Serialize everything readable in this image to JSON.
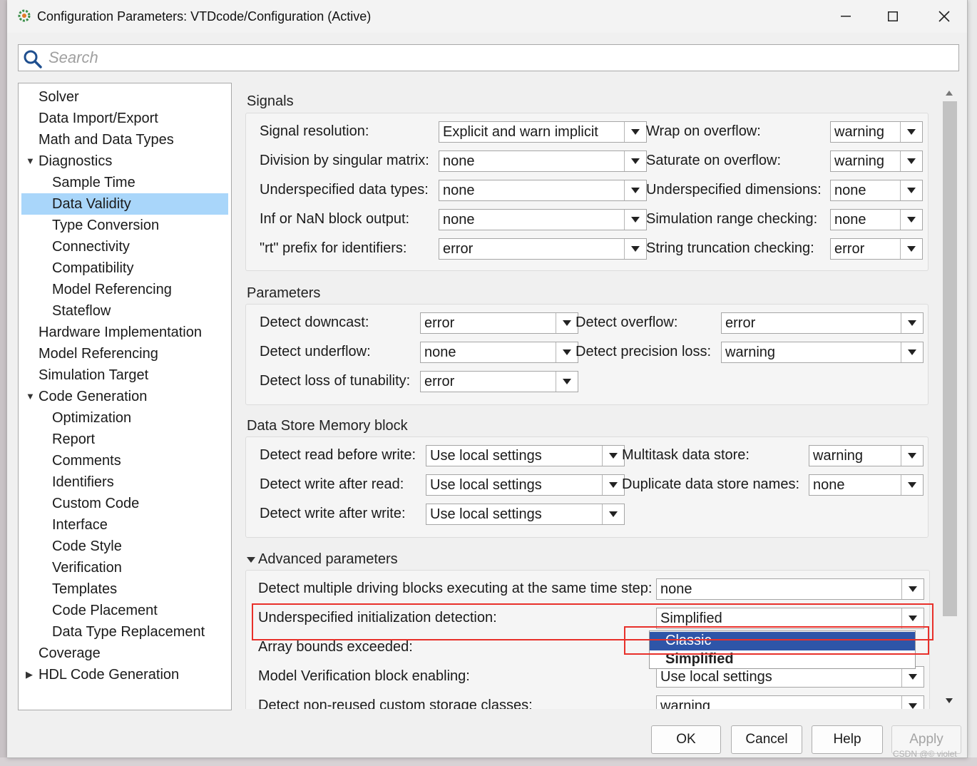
{
  "window": {
    "title": "Configuration Parameters: VTDcode/Configuration (Active)",
    "minimize": "—",
    "maximize": "☐",
    "close": "✕"
  },
  "search": {
    "placeholder": "Search"
  },
  "tree": [
    {
      "label": "Solver",
      "level": 0
    },
    {
      "label": "Data Import/Export",
      "level": 0
    },
    {
      "label": "Math and Data Types",
      "level": 0
    },
    {
      "label": "Diagnostics",
      "level": 0,
      "expanded": true
    },
    {
      "label": "Sample Time",
      "level": 1
    },
    {
      "label": "Data Validity",
      "level": 1,
      "selected": true
    },
    {
      "label": "Type Conversion",
      "level": 1
    },
    {
      "label": "Connectivity",
      "level": 1
    },
    {
      "label": "Compatibility",
      "level": 1
    },
    {
      "label": "Model Referencing",
      "level": 1
    },
    {
      "label": "Stateflow",
      "level": 1
    },
    {
      "label": "Hardware Implementation",
      "level": 0
    },
    {
      "label": "Model Referencing",
      "level": 0
    },
    {
      "label": "Simulation Target",
      "level": 0
    },
    {
      "label": "Code Generation",
      "level": 0,
      "expanded": true
    },
    {
      "label": "Optimization",
      "level": 1
    },
    {
      "label": "Report",
      "level": 1
    },
    {
      "label": "Comments",
      "level": 1
    },
    {
      "label": "Identifiers",
      "level": 1
    },
    {
      "label": "Custom Code",
      "level": 1
    },
    {
      "label": "Interface",
      "level": 1
    },
    {
      "label": "Code Style",
      "level": 1
    },
    {
      "label": "Verification",
      "level": 1
    },
    {
      "label": "Templates",
      "level": 1
    },
    {
      "label": "Code Placement",
      "level": 1
    },
    {
      "label": "Data Type Replacement",
      "level": 1
    },
    {
      "label": "Coverage",
      "level": 0
    },
    {
      "label": "HDL Code Generation",
      "level": 0,
      "expanded": false
    }
  ],
  "signals": {
    "title": "Signals",
    "left": [
      {
        "label": "Signal resolution:",
        "value": "Explicit and warn implicit"
      },
      {
        "label": "Division by singular matrix:",
        "value": "none"
      },
      {
        "label": "Underspecified data types:",
        "value": "none"
      },
      {
        "label": "Inf or NaN block output:",
        "value": "none"
      },
      {
        "label": "\"rt\" prefix for identifiers:",
        "value": "error"
      }
    ],
    "right": [
      {
        "label": "Wrap on overflow:",
        "value": "warning"
      },
      {
        "label": "Saturate on overflow:",
        "value": "warning"
      },
      {
        "label": "Underspecified dimensions:",
        "value": "none"
      },
      {
        "label": "Simulation range checking:",
        "value": "none"
      },
      {
        "label": "String truncation checking:",
        "value": "error"
      }
    ]
  },
  "parameters": {
    "title": "Parameters",
    "left": [
      {
        "label": "Detect downcast:",
        "value": "error"
      },
      {
        "label": "Detect underflow:",
        "value": "none"
      },
      {
        "label": "Detect loss of tunability:",
        "value": "error"
      }
    ],
    "right": [
      {
        "label": "Detect overflow:",
        "value": "error"
      },
      {
        "label": "Detect precision loss:",
        "value": "warning"
      }
    ]
  },
  "dsm": {
    "title": "Data Store Memory block",
    "left": [
      {
        "label": "Detect read before write:",
        "value": "Use local settings"
      },
      {
        "label": "Detect write after read:",
        "value": "Use local settings"
      },
      {
        "label": "Detect write after write:",
        "value": "Use local settings"
      }
    ],
    "right": [
      {
        "label": "Multitask data store:",
        "value": "warning"
      },
      {
        "label": "Duplicate data store names:",
        "value": "none"
      }
    ]
  },
  "advanced": {
    "title": "Advanced parameters",
    "rows": [
      {
        "label": "Detect multiple driving blocks executing at the same time step:",
        "value": "none"
      },
      {
        "label": "Underspecified initialization detection:",
        "value": "Simplified"
      },
      {
        "label": "Array bounds exceeded:",
        "value": ""
      },
      {
        "label": "Model Verification block enabling:",
        "value": "Use local settings"
      },
      {
        "label": "Detect non-reused custom storage classes:",
        "value": "warning"
      }
    ],
    "popup_options": [
      "Classic",
      "Simplified"
    ]
  },
  "buttons": {
    "ok": "OK",
    "cancel": "Cancel",
    "help": "Help",
    "apply": "Apply"
  },
  "watermark": "CSDN @© violet",
  "colors": {
    "selection": "#a9d6fa",
    "popup_highlight": "#2e55a8",
    "annotation_red": "#e8302a"
  }
}
